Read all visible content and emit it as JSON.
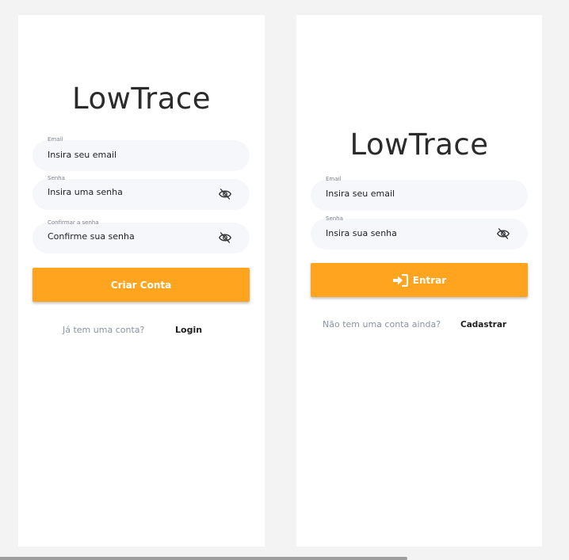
{
  "signup": {
    "logo": "LowTrace",
    "email": {
      "label": "Email",
      "value": "Insira seu email"
    },
    "password": {
      "label": "Senha",
      "value": "Insira uma senha"
    },
    "confirm": {
      "label": "Confirmar a senha",
      "value": "Confirme sua senha"
    },
    "submit_label": "Criar Conta",
    "footer": {
      "prompt": "Já tem uma conta?",
      "link": "Login"
    }
  },
  "login": {
    "logo": "LowTrace",
    "email": {
      "label": "Email",
      "value": "Insira seu email"
    },
    "password": {
      "label": "Senha",
      "value": "Insira sua senha"
    },
    "submit_label": "Entrar",
    "footer": {
      "prompt": "Não tem uma conta ainda?",
      "link": "Cadastrar"
    }
  },
  "colors": {
    "accent": "#ffa41f",
    "field_bg": "#f5f7fa",
    "background": "#f3f3f3",
    "muted_text": "#8a93a3"
  },
  "icons": {
    "eye": "eye-off-icon",
    "enter": "sign-in-icon"
  }
}
